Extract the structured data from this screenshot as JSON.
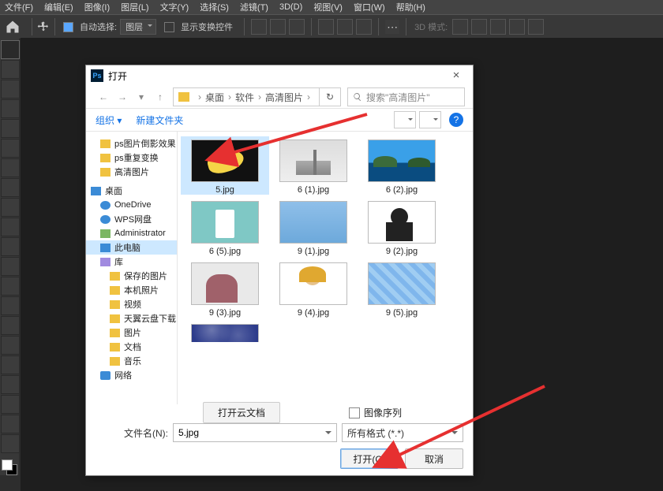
{
  "menubar": {
    "items": [
      "文件(F)",
      "编辑(E)",
      "图像(I)",
      "图层(L)",
      "文字(Y)",
      "选择(S)",
      "滤镜(T)",
      "3D(D)",
      "视图(V)",
      "窗口(W)",
      "帮助(H)"
    ]
  },
  "optbar": {
    "auto_select": "自动选择:",
    "auto_select_value": "图层",
    "show_transform": "显示变换控件",
    "mode3d": "3D 模式:"
  },
  "dialog": {
    "title": "打开",
    "nav": {
      "back": "←",
      "forward": "→",
      "up": "↑",
      "path_segments": [
        "桌面",
        "软件",
        "高清图片"
      ],
      "search_placeholder": "搜索\"高清图片\""
    },
    "toolbar": {
      "organize": "组织 ▾",
      "new_folder": "新建文件夹"
    },
    "tree": [
      {
        "label": "ps图片倒影效果",
        "icon": "folder",
        "indent": 1
      },
      {
        "label": "ps重复变换",
        "icon": "folder",
        "indent": 1
      },
      {
        "label": "高清图片",
        "icon": "folder",
        "indent": 1
      },
      {
        "label": "桌面",
        "icon": "blue",
        "indent": 0,
        "gap": true
      },
      {
        "label": "OneDrive",
        "icon": "cloud",
        "indent": 1
      },
      {
        "label": "WPS网盘",
        "icon": "cloud",
        "indent": 1
      },
      {
        "label": "Administrator",
        "icon": "user",
        "indent": 1
      },
      {
        "label": "此电脑",
        "icon": "pc",
        "indent": 1,
        "selected": true
      },
      {
        "label": "库",
        "icon": "lib",
        "indent": 1
      },
      {
        "label": "保存的图片",
        "icon": "folder",
        "indent": 2
      },
      {
        "label": "本机照片",
        "icon": "folder",
        "indent": 2
      },
      {
        "label": "视频",
        "icon": "folder",
        "indent": 2
      },
      {
        "label": "天翼云盘下载",
        "icon": "folder",
        "indent": 2
      },
      {
        "label": "图片",
        "icon": "folder",
        "indent": 2
      },
      {
        "label": "文档",
        "icon": "folder",
        "indent": 2
      },
      {
        "label": "音乐",
        "icon": "folder",
        "indent": 2
      },
      {
        "label": "网络",
        "icon": "net",
        "indent": 1
      }
    ],
    "files": [
      {
        "label": "5.jpg",
        "thumb": "th-banana",
        "selected": true
      },
      {
        "label": "6 (1).jpg",
        "thumb": "th-city"
      },
      {
        "label": "6 (2).jpg",
        "thumb": "th-lake"
      },
      {
        "label": "6 (5).jpg",
        "thumb": "th-teal"
      },
      {
        "label": "9 (1).jpg",
        "thumb": "th-blue1"
      },
      {
        "label": "9 (2).jpg",
        "thumb": "th-girl1"
      },
      {
        "label": "9 (3).jpg",
        "thumb": "th-girl2"
      },
      {
        "label": "9 (4).jpg",
        "thumb": "th-girl3"
      },
      {
        "label": "9 (5).jpg",
        "thumb": "th-blue2"
      },
      {
        "label": "",
        "thumb": "th-blue3",
        "partial": true
      }
    ],
    "cloud_button": "打开云文档",
    "image_sequence": "图像序列",
    "filename_label": "文件名(N):",
    "filename_value": "5.jpg",
    "filetype_value": "所有格式 (*.*)",
    "open_btn": "打开(O)",
    "cancel_btn": "取消"
  }
}
